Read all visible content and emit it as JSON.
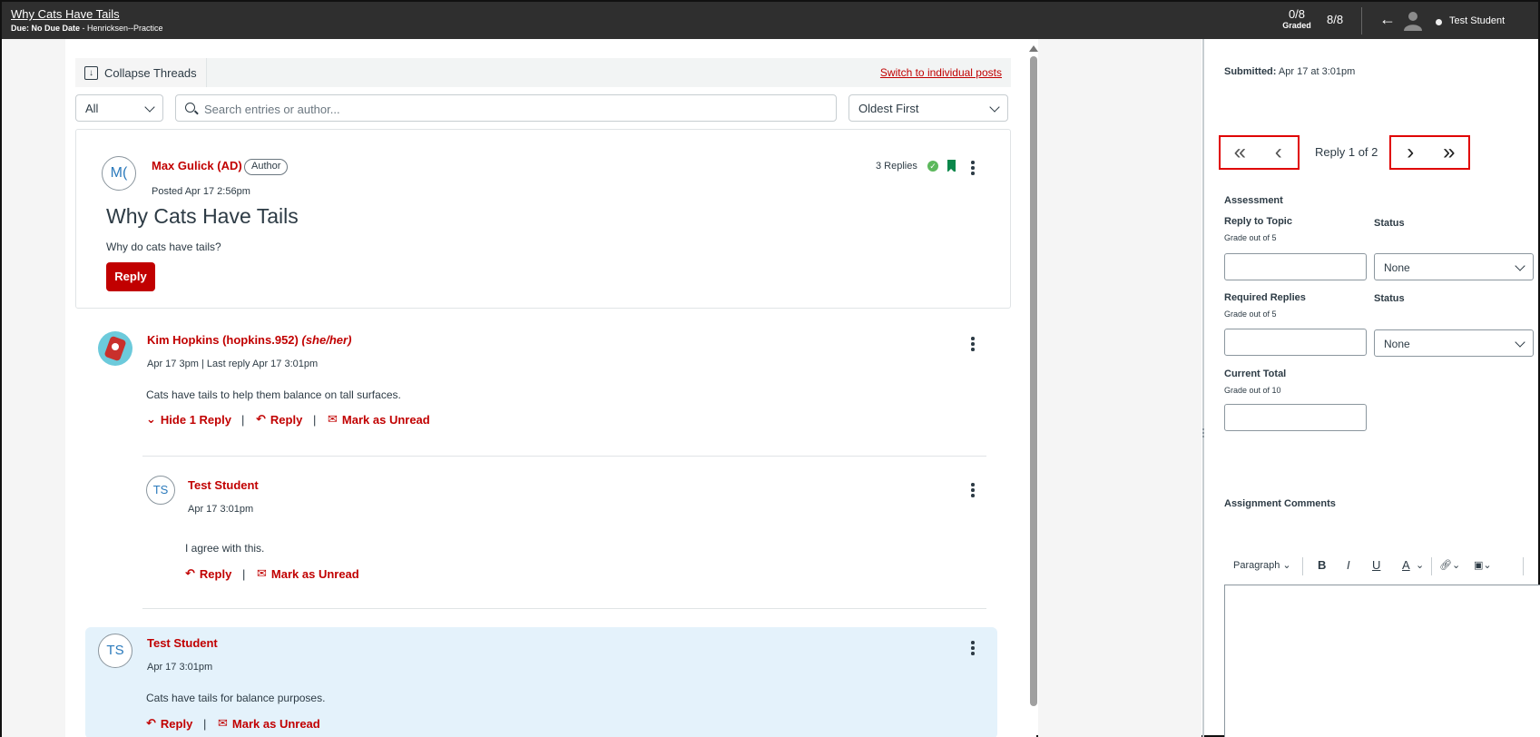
{
  "topbar": {
    "title": "Why Cats Have Tails",
    "due_label": "Due: No Due Date",
    "due_course": " - Henricksen--Practice",
    "graded_count": "0/8",
    "graded_label": "Graded",
    "submissions_count": "8/8",
    "back_icon": "←",
    "user_name": "Test Student"
  },
  "toolbar": {
    "collapse_label": "Collapse Threads",
    "switch_link": "Switch to individual posts"
  },
  "filters": {
    "filter_value": "All",
    "search_placeholder": "Search entries or author...",
    "sort_value": "Oldest First"
  },
  "topic": {
    "avatar_initials": "M(",
    "author_name": "Max Gulick (AD)",
    "author_badge": "Author",
    "posted": "Posted Apr 17 2:56pm",
    "replies_count": "3 Replies",
    "title": "Why Cats Have Tails",
    "message": "Why do cats have tails?",
    "reply_label": "Reply"
  },
  "entries": [
    {
      "author_name": "Kim Hopkins (hopkins.952)",
      "pronouns": "(she/her)",
      "meta": "Apr 17 3pm",
      "last_reply": "| Last reply Apr 17 3:01pm",
      "message": "Cats have tails to help them balance on tall surfaces.",
      "hide_label": "Hide 1 Reply",
      "reply_label": "Reply",
      "unread_label": "Mark as Unread"
    },
    {
      "avatar_initials": "TS",
      "author_name": "Test Student",
      "meta": "Apr 17 3:01pm",
      "message": "I agree with this.",
      "reply_label": "Reply",
      "unread_label": "Mark as Unread"
    },
    {
      "avatar_initials": "TS",
      "author_name": "Test Student",
      "meta": "Apr 17 3:01pm",
      "message": "Cats have tails for balance purposes.",
      "reply_label": "Reply",
      "unread_label": "Mark as Unread"
    }
  ],
  "grading": {
    "submitted_label": "Submitted:",
    "submitted_value": "Apr 17 at 3:01pm",
    "reply_position": "Reply 1 of 2",
    "assessment_label": "Assessment",
    "reply_topic_label": "Reply to Topic",
    "reply_topic_grade": "Grade out of 5",
    "status_label": "Status",
    "status_value_1": "None",
    "required_replies_label": "Required Replies",
    "required_replies_grade": "Grade out of 5",
    "status_value_2": "None",
    "current_total_label": "Current Total",
    "current_total_grade": "Grade out of 10",
    "comments_label": "Assignment Comments",
    "paragraph_label": "Paragraph",
    "bold": "B",
    "italic": "I",
    "underline": "U",
    "text_color": "A"
  },
  "colors": {
    "accent": "#c10000",
    "topbar": "#2f2f2f",
    "highlight": "#e4f2fb",
    "nav_border": "#e00000"
  }
}
